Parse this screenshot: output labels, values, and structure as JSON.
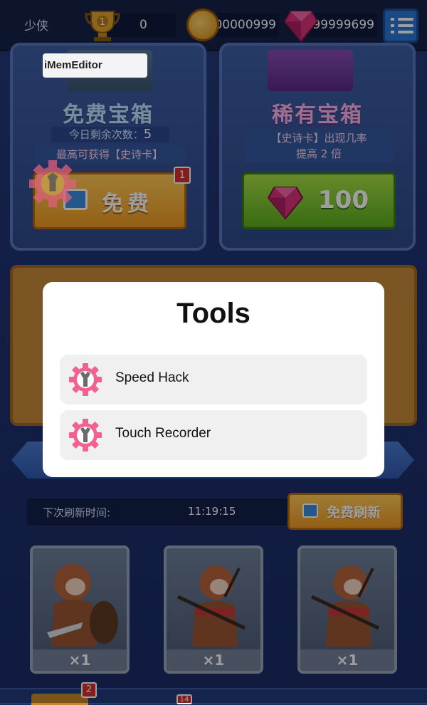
{
  "topbar": {
    "player_name": "少侠",
    "trophy_count": "0",
    "trophy_badge": "1",
    "coins": "100000999",
    "gems": "99999699"
  },
  "free_chest": {
    "title": "免费宝箱",
    "remaining_label": "今日剩余次数：",
    "remaining_count": "5",
    "max_reward": "最高可获得【史诗卡】",
    "button_label": "免费",
    "badge": "1"
  },
  "rare_chest": {
    "title": "稀有宝箱",
    "odds_line1": "【史诗卡】出现几率",
    "odds_line2": "提高 2 倍",
    "price": "100"
  },
  "refresh": {
    "label": "下次刷新时间:",
    "time": "11:19:15",
    "button_label": "免费刷新"
  },
  "heroes": [
    {
      "count": "×1"
    },
    {
      "count": "×1"
    },
    {
      "count": "×1"
    }
  ],
  "tabbar": {
    "badge_chest": "2",
    "badge_second": "14"
  },
  "overlay": {
    "app_label": "iMemEditor",
    "title": "Tools",
    "tools": [
      {
        "label": "Speed Hack",
        "icon": "gear-wrench-icon"
      },
      {
        "label": "Touch Recorder",
        "icon": "gear-wrench-icon"
      }
    ]
  },
  "colors": {
    "tool_icon": "#f0628f",
    "button_orange": "#f0a03a",
    "button_green": "#6cbc2a"
  }
}
